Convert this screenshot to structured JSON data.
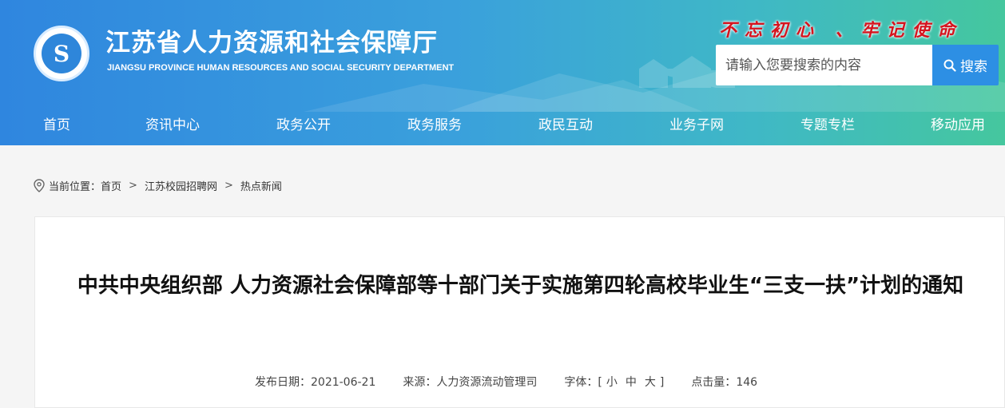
{
  "header": {
    "title": "江苏省人力资源和社会保障厅",
    "subtitle": "JIANGSU PROVINCE HUMAN RESOURCES AND SOCIAL SECURITY DEPARTMENT",
    "slogan": "不忘初心 、牢记使命",
    "logo_glyph": "S"
  },
  "search": {
    "placeholder": "请输入您要搜索的内容",
    "button_label": "搜索"
  },
  "nav": {
    "items": [
      {
        "label": "首页"
      },
      {
        "label": "资讯中心"
      },
      {
        "label": "政务公开"
      },
      {
        "label": "政务服务"
      },
      {
        "label": "政民互动"
      },
      {
        "label": "业务子网"
      },
      {
        "label": "专题专栏"
      },
      {
        "label": "移动应用"
      }
    ]
  },
  "breadcrumb": {
    "prefix": "当前位置：",
    "items": [
      "首页",
      "江苏校园招聘网",
      "热点新闻"
    ],
    "separator": ">"
  },
  "article": {
    "title": "中共中央组织部 人力资源社会保障部等十部门关于实施第四轮高校毕业生“三支一扶”计划的通知",
    "publish_label": "发布日期：",
    "publish_date": "2021-06-21",
    "source_label": "来源：",
    "source": "人力资源流动管理司",
    "font_label": "字体：[",
    "font_small": "小",
    "font_medium": "中",
    "font_large": "大",
    "font_close": "]",
    "clicks_label": "点击量：",
    "clicks": "146"
  },
  "colors": {
    "header_start": "#2f86df",
    "header_end": "#45c79e",
    "slogan": "#d6131e",
    "search_button": "#2d8fe4"
  }
}
